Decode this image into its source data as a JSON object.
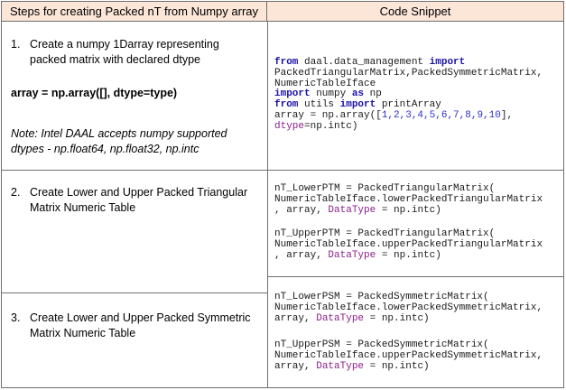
{
  "header": {
    "left": "Steps for creating Packed nT from Numpy array",
    "right": "Code Snippet"
  },
  "steps": [
    {
      "number": "1.",
      "text_line1": "Create a numpy 1Darray representing",
      "text_line2": "packed matrix with declared dtype"
    },
    {
      "number": "2.",
      "text_line1": "Create Lower and Upper Packed Triangular",
      "text_line2": "Matrix Numeric Table"
    },
    {
      "number": "3.",
      "text_line1": "Create Lower and Upper Packed Symmetric",
      "text_line2": "Matrix Numeric Table"
    }
  ],
  "array_statement": "array = np.array([], dtype=type)",
  "note_line1": "Note: Intel DAAL accepts numpy supported",
  "note_line2": "dtypes - np.float64, np.float32, np.intc",
  "code1": {
    "l1_kw_from": "from",
    "l1_mod": " daal.data_management ",
    "l1_kw_import": "import",
    "l2": "PackedTriangularMatrix,PackedSymmetricMatrix,",
    "l3": "NumericTableIface",
    "l4_kw_import": "import",
    "l4_mid": " numpy ",
    "l4_kw_as": "as",
    "l4_end": " np",
    "l5_kw_from": "from",
    "l5_mid": " utils ",
    "l5_kw_import": "import",
    "l5_end": " printArray",
    "l6_a": "array = np.array([",
    "l6_nums": "1,2,3,4,5,6,7,8,9,10",
    "l6_b": "],",
    "l7_param": "dtype",
    "l7_end": "=np.intc)"
  },
  "code2a": {
    "l1": "nT_LowerPTM = PackedTriangularMatrix(",
    "l2": "NumericTableIface.lowerPackedTriangularMatrix",
    "l3_a": ", array, ",
    "l3_param": "DataType",
    "l3_end": " = np.intc)"
  },
  "code2b": {
    "l1": "nT_UpperPTM = PackedTriangularMatrix(",
    "l2": "NumericTableIface.upperPackedTriangularMatrix",
    "l3_a": ", array, ",
    "l3_param": "DataType",
    "l3_end": " = np.intc)"
  },
  "code3a": {
    "l1": "nT_LowerPSM = PackedSymmetricMatrix(",
    "l2": "NumericTableIface.lowerPackedSymmetricMatrix,",
    "l3_a": "array, ",
    "l3_param": "DataType",
    "l3_end": " = np.intc)"
  },
  "code3b": {
    "l1": "nT_UpperPSM = PackedSymmetricMatrix(",
    "l2": "NumericTableIface.upperPackedSymmetricMatrix,",
    "l3_a": "array, ",
    "l3_param": "DataType",
    "l3_end": " = np.intc)"
  }
}
